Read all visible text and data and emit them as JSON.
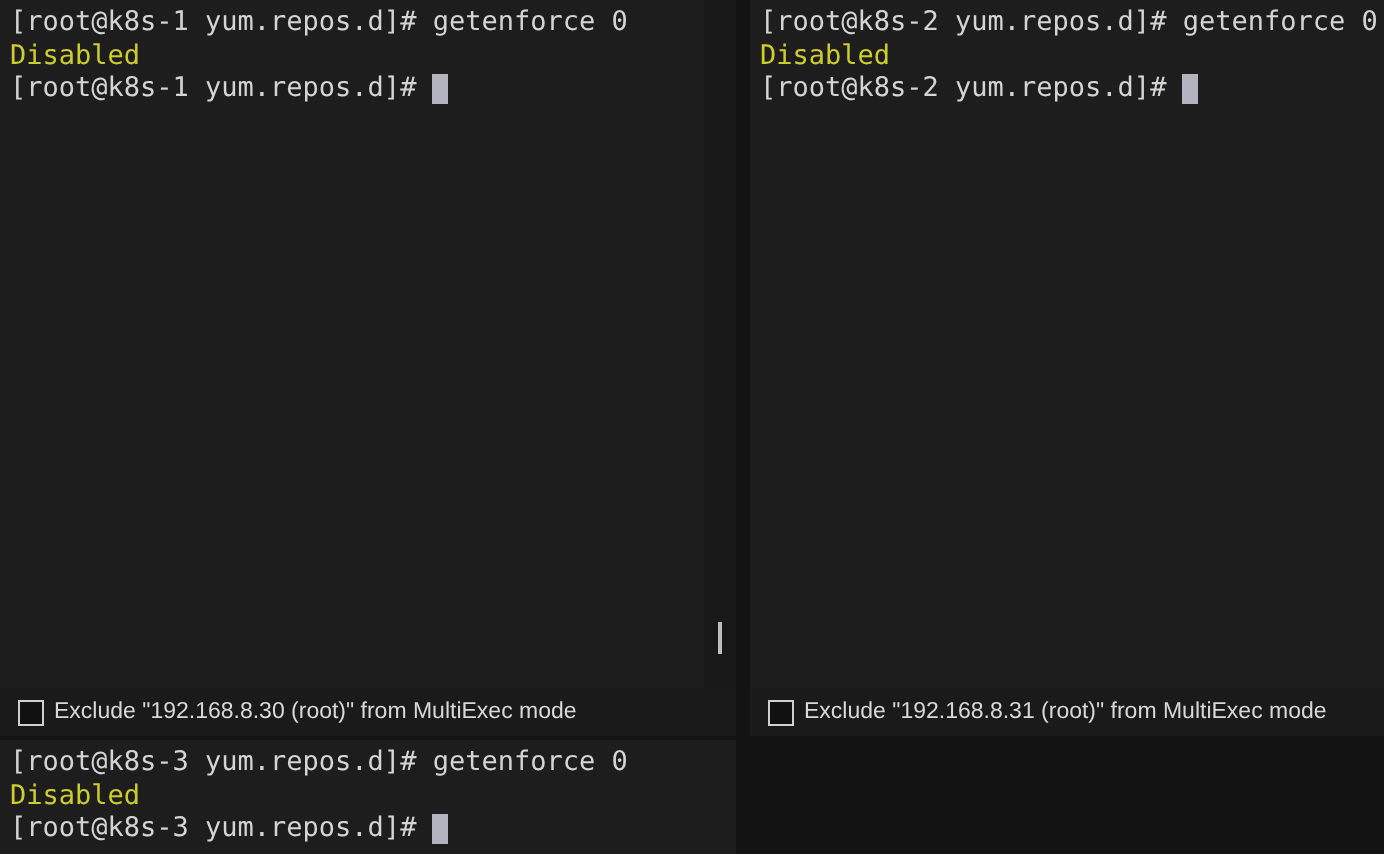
{
  "panes": [
    {
      "scrollbar": true,
      "cursor": true,
      "lines": [
        {
          "kind": "input",
          "text": "[root@k8s-1 yum.repos.d]# getenforce 0"
        },
        {
          "kind": "output",
          "text": "Disabled"
        },
        {
          "kind": "input",
          "text": "[root@k8s-1 yum.repos.d]#"
        }
      ],
      "exclude": {
        "label": "Exclude \"192.168.8.30 (root)\" from MultiExec mode",
        "checked": false
      }
    },
    {
      "cursor": true,
      "lines": [
        {
          "kind": "input",
          "text": "[root@k8s-2 yum.repos.d]# getenforce 0"
        },
        {
          "kind": "output",
          "text": "Disabled"
        },
        {
          "kind": "input",
          "text": "[root@k8s-2 yum.repos.d]#"
        }
      ],
      "exclude": {
        "label": "Exclude \"192.168.8.31 (root)\" from MultiExec mode",
        "checked": false
      }
    },
    {
      "cursor": true,
      "lines": [
        {
          "kind": "input",
          "text": "[root@k8s-3 yum.repos.d]# getenforce 0"
        },
        {
          "kind": "output",
          "text": "Disabled"
        },
        {
          "kind": "input",
          "text": "[root@k8s-3 yum.repos.d]#"
        }
      ]
    }
  ]
}
